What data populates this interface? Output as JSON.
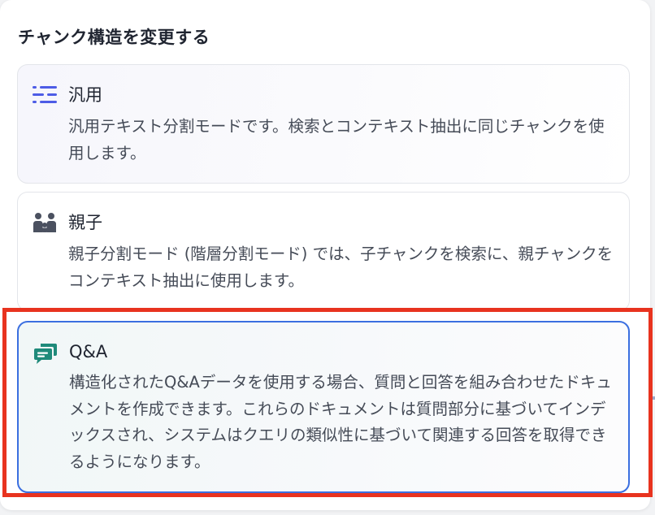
{
  "dialog": {
    "title": "チャンク構造を変更する"
  },
  "options": {
    "general": {
      "icon": "list-lines-icon",
      "name": "汎用",
      "description": "汎用テキスト分割モードです。検索とコンテキスト抽出に同じチャンクを使用します。"
    },
    "parent_child": {
      "icon": "parent-child-icon",
      "name": "親子",
      "description": "親子分割モード (階層分割モード) では、子チャンクを検索に、親チャンクをコンテキスト抽出に使用します。"
    },
    "qa": {
      "icon": "qa-chat-icon",
      "name": "Q&A",
      "description": "構造化されたQ&Aデータを使用する場合、質問と回答を組み合わせたドキュメントを作成できます。これらのドキュメントは質問部分に基づいてインデックスされ、システムはクエリの類似性に基づいて関連する回答を取得できるようになります。",
      "selected": true
    }
  },
  "colors": {
    "general_icon": "#4d5ce6",
    "parent_child_icon": "#4b5160",
    "qa_icon": "#1f8a7a",
    "selected_border": "#3b6fe0",
    "annotation_highlight": "#e8331f"
  }
}
